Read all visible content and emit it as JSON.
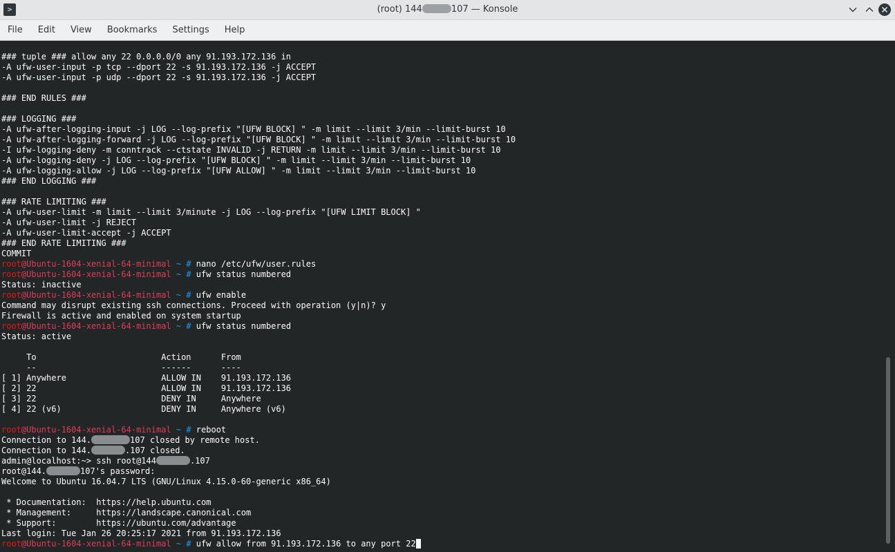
{
  "window": {
    "title_prefix": "(root) 144",
    "title_suffix": "107 — Konsole"
  },
  "menu": [
    "File",
    "Edit",
    "View",
    "Bookmarks",
    "Settings",
    "Help"
  ],
  "prompt": {
    "user": "root",
    "host": "@Ubuntu-1604-xenial-64-minimal",
    "path": " ~",
    "symbol": " # "
  },
  "terminal": {
    "top_lines": [
      "### tuple ### allow any 22 0.0.0.0/0 any 91.193.172.136 in",
      "-A ufw-user-input -p tcp --dport 22 -s 91.193.172.136 -j ACCEPT",
      "-A ufw-user-input -p udp --dport 22 -s 91.193.172.136 -j ACCEPT",
      "",
      "### END RULES ###",
      "",
      "### LOGGING ###",
      "-A ufw-after-logging-input -j LOG --log-prefix \"[UFW BLOCK] \" -m limit --limit 3/min --limit-burst 10",
      "-A ufw-after-logging-forward -j LOG --log-prefix \"[UFW BLOCK] \" -m limit --limit 3/min --limit-burst 10",
      "-I ufw-logging-deny -m conntrack --ctstate INVALID -j RETURN -m limit --limit 3/min --limit-burst 10",
      "-A ufw-logging-deny -j LOG --log-prefix \"[UFW BLOCK] \" -m limit --limit 3/min --limit-burst 10",
      "-A ufw-logging-allow -j LOG --log-prefix \"[UFW ALLOW] \" -m limit --limit 3/min --limit-burst 10",
      "### END LOGGING ###",
      "",
      "### RATE LIMITING ###",
      "-A ufw-user-limit -m limit --limit 3/minute -j LOG --log-prefix \"[UFW LIMIT BLOCK] \"",
      "-A ufw-user-limit -j REJECT",
      "-A ufw-user-limit-accept -j ACCEPT",
      "### END RATE LIMITING ###",
      "COMMIT"
    ],
    "cmd_nano": "nano /etc/ufw/user.rules",
    "cmd_status1": "ufw status numbered",
    "status_inactive": "Status: inactive",
    "cmd_enable": "ufw enable",
    "enable_warning": "Command may disrupt existing ssh connections. Proceed with operation (y|n)? y",
    "firewall_active": "Firewall is active and enabled on system startup",
    "cmd_status2": "ufw status numbered",
    "status_active": "Status: active",
    "table_header": "     To                         Action      From",
    "table_separator": "     --                         ------      ----",
    "table_rows": [
      "[ 1] Anywhere                   ALLOW IN    91.193.172.136",
      "[ 2] 22                         ALLOW IN    91.193.172.136",
      "[ 3] 22                         DENY IN     Anywhere",
      "[ 4] 22 (v6)                    DENY IN     Anywhere (v6)"
    ],
    "cmd_reboot": "reboot",
    "conn_closed_remote_a": "Connection to 144.",
    "conn_closed_remote_b": "107 closed by remote host.",
    "conn_closed_a": "Connection to 144.",
    "conn_closed_b": ".107 closed.",
    "ssh_prompt_a": "admin@localhost:~> ssh root@144",
    "ssh_prompt_b": ".107",
    "password_a": "root@144.",
    "password_b": "107's password:",
    "welcome": "Welcome to Ubuntu 16.04.7 LTS (GNU/Linux 4.15.0-60-generic x86_64)",
    "motd": [
      " * Documentation:  https://help.ubuntu.com",
      " * Management:     https://landscape.canonical.com",
      " * Support:        https://ubuntu.com/advantage"
    ],
    "last_login": "Last login: Tue Jan 26 20:25:17 2021 from 91.193.172.136",
    "current_cmd": "ufw allow from 91.193.172.136 to any port 22"
  }
}
